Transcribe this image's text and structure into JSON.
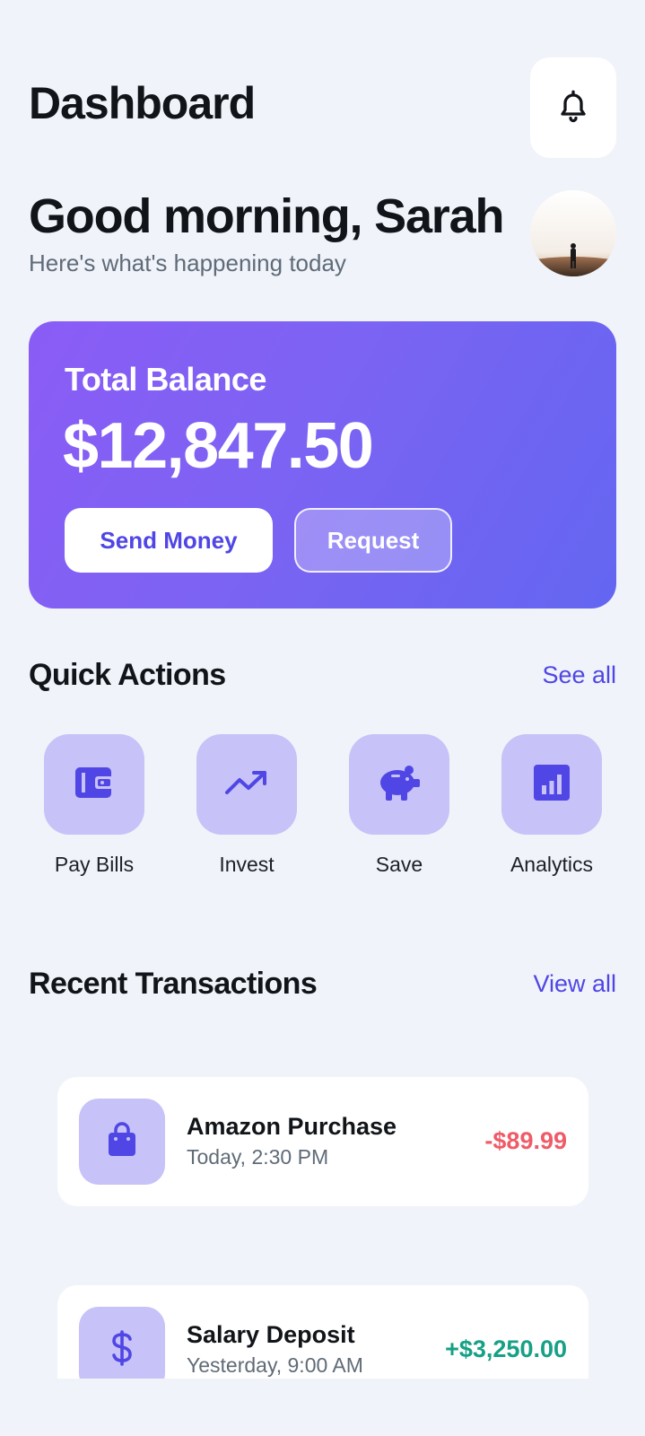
{
  "header": {
    "title": "Dashboard",
    "bell_icon": "bell-icon"
  },
  "greeting": {
    "title": "Good morning, Sarah",
    "subtitle": "Here's what's happening today",
    "avatar": "user-avatar"
  },
  "balance": {
    "label": "Total Balance",
    "amount": "$12,847.50",
    "send_label": "Send Money",
    "request_label": "Request"
  },
  "quick_actions": {
    "title": "Quick Actions",
    "link": "See all",
    "items": [
      {
        "label": "Pay Bills",
        "icon": "wallet-icon"
      },
      {
        "label": "Invest",
        "icon": "trending-up-icon"
      },
      {
        "label": "Save",
        "icon": "piggy-bank-icon"
      },
      {
        "label": "Analytics",
        "icon": "bar-chart-icon"
      }
    ]
  },
  "transactions": {
    "title": "Recent Transactions",
    "link": "View all",
    "items": [
      {
        "title": "Amazon Purchase",
        "time": "Today, 2:30 PM",
        "amount": "-$89.99",
        "icon": "shopping-bag-icon"
      },
      {
        "title": "Salary Deposit",
        "time": "Yesterday, 9:00 AM",
        "amount": "+$3,250.00",
        "icon": "dollar-icon"
      }
    ]
  },
  "colors": {
    "accent": "#4f46e5",
    "negative": "#ef5b67",
    "positive": "#16a085",
    "background": "#f0f3f9"
  }
}
